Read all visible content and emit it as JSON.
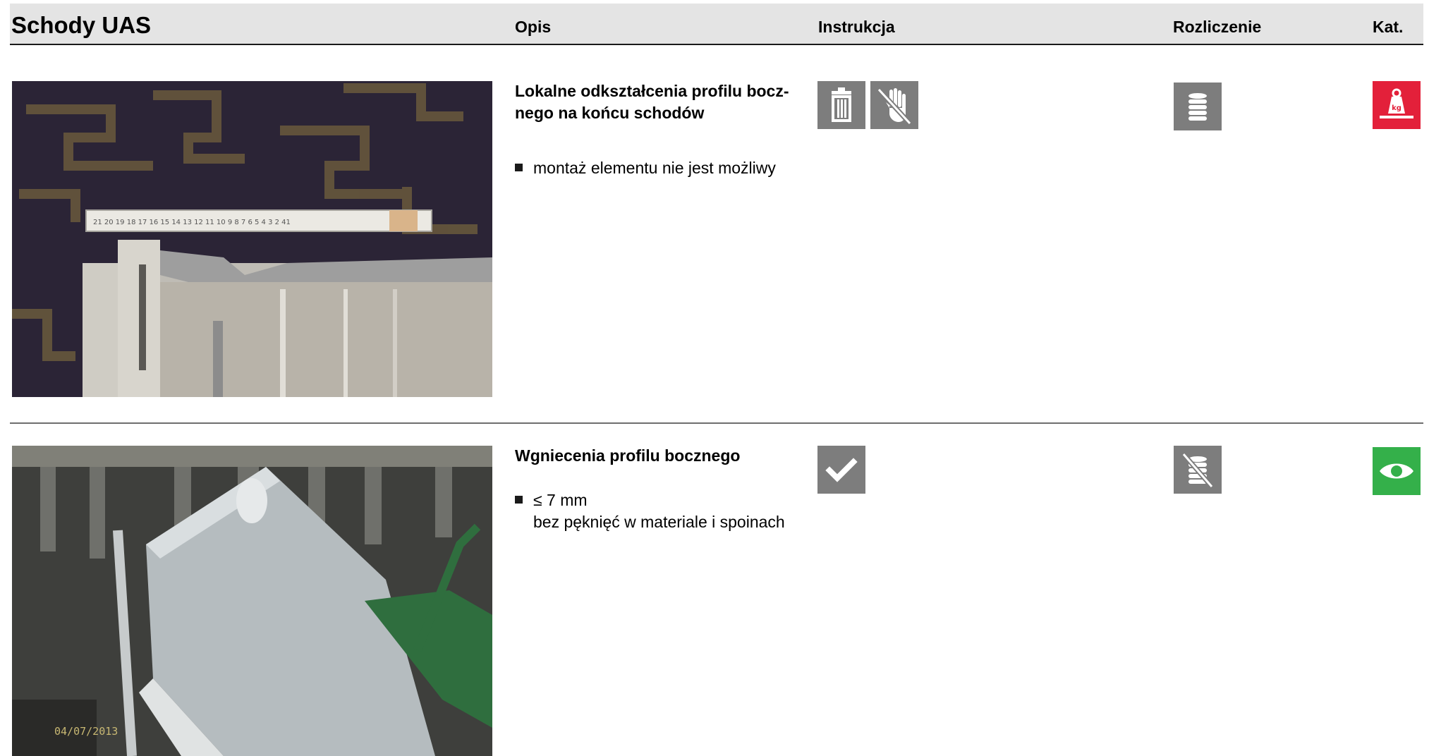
{
  "header": {
    "title": "Schody UAS",
    "col_opis": "Opis",
    "col_instrukcja": "Instrukcja",
    "col_rozliczenie": "Rozliczenie",
    "col_kat": "Kat."
  },
  "items": [
    {
      "title": "Lokalne odkształcenia profilu bocz-\nnego na końcu schodów",
      "bullet_lines": [
        "montaż elementu nie jest możliwy"
      ],
      "instruction_icons": [
        "trash-icon",
        "no-touch-hand-icon"
      ],
      "billing_icon": "coin-stack-icon",
      "category_icon": "weight-kg-icon",
      "category_color": "#e3203a"
    },
    {
      "title": "Wgniecenia profilu bocznego",
      "bullet_lines": [
        "≤ 7 mm",
        "bez pęknięć w materiale i spoinach"
      ],
      "photo_date_stamp": "04/07/2013",
      "instruction_icons": [
        "checkmark-icon"
      ],
      "billing_icon": "no-coin-stack-icon",
      "category_icon": "eye-icon",
      "category_color": "#34b04a"
    }
  ]
}
